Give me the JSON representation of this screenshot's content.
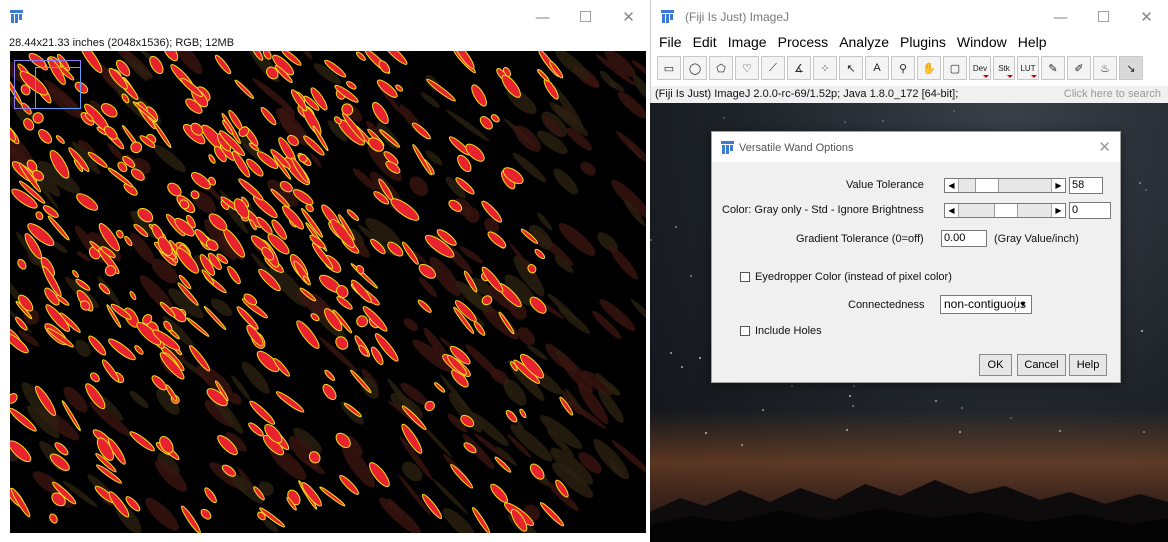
{
  "image_window": {
    "title": "",
    "info": "28.44x21.33 inches (2048x1536); RGB; 12MB",
    "window_buttons": {
      "minimize": "—",
      "maximize": "☐",
      "close": "✕"
    }
  },
  "imagej_window": {
    "title": "(Fiji Is Just) ImageJ",
    "window_buttons": {
      "minimize": "—",
      "maximize": "☐",
      "close": "✕"
    },
    "menu": [
      "File",
      "Edit",
      "Image",
      "Process",
      "Analyze",
      "Plugins",
      "Window",
      "Help"
    ],
    "tools": [
      {
        "name": "rectangle-tool",
        "glyph": "▭"
      },
      {
        "name": "oval-tool",
        "glyph": "◯"
      },
      {
        "name": "polygon-tool",
        "glyph": "⬠"
      },
      {
        "name": "freehand-tool",
        "glyph": "♡"
      },
      {
        "name": "line-tool",
        "glyph": "⟋"
      },
      {
        "name": "angle-tool",
        "glyph": "∡"
      },
      {
        "name": "point-tool",
        "glyph": "⁘"
      },
      {
        "name": "wand-tool",
        "glyph": "↖"
      },
      {
        "name": "text-tool",
        "glyph": "A"
      },
      {
        "name": "zoom-tool",
        "glyph": "⚲"
      },
      {
        "name": "hand-tool",
        "glyph": "✋"
      },
      {
        "name": "color-picker-tool",
        "glyph": "▢"
      },
      {
        "name": "dev-tool",
        "glyph": "Dev"
      },
      {
        "name": "stk-tool",
        "glyph": "Stk"
      },
      {
        "name": "lut-tool",
        "glyph": "LUT"
      },
      {
        "name": "pencil-tool",
        "glyph": "✎"
      },
      {
        "name": "brush-tool",
        "glyph": "✐"
      },
      {
        "name": "flood-fill-tool",
        "glyph": "♨"
      },
      {
        "name": "versatile-wand-tool",
        "glyph": "↘"
      }
    ],
    "status": "(Fiji Is Just) ImageJ 2.0.0-rc-69/1.52p; Java 1.8.0_172 [64-bit];",
    "search_hint": "Click here to search"
  },
  "dialog": {
    "title": "Versatile Wand Options",
    "close": "✕",
    "value_tolerance": {
      "label": "Value Tolerance",
      "value": "58",
      "slider_fraction": 0.23
    },
    "color_mode": {
      "label": "Color: Gray only - Std - Ignore Brightness",
      "value": "0",
      "slider_fraction": 0.5
    },
    "gradient": {
      "label": "Gradient Tolerance (0=off)",
      "value": "0.00",
      "unit": "(Gray Value/inch)"
    },
    "eyedropper": {
      "label": "Eyedropper Color (instead of pixel color)",
      "checked": false
    },
    "connectedness": {
      "label": "Connectedness",
      "value": "non-contiguous"
    },
    "include_holes": {
      "label": "Include Holes",
      "checked": false
    },
    "buttons": {
      "ok": "OK",
      "cancel": "Cancel",
      "help": "Help"
    }
  },
  "colors": {
    "accent": "#1f5fbf",
    "segment_fill": "#e8222e",
    "segment_outline": "#f2e01a"
  }
}
